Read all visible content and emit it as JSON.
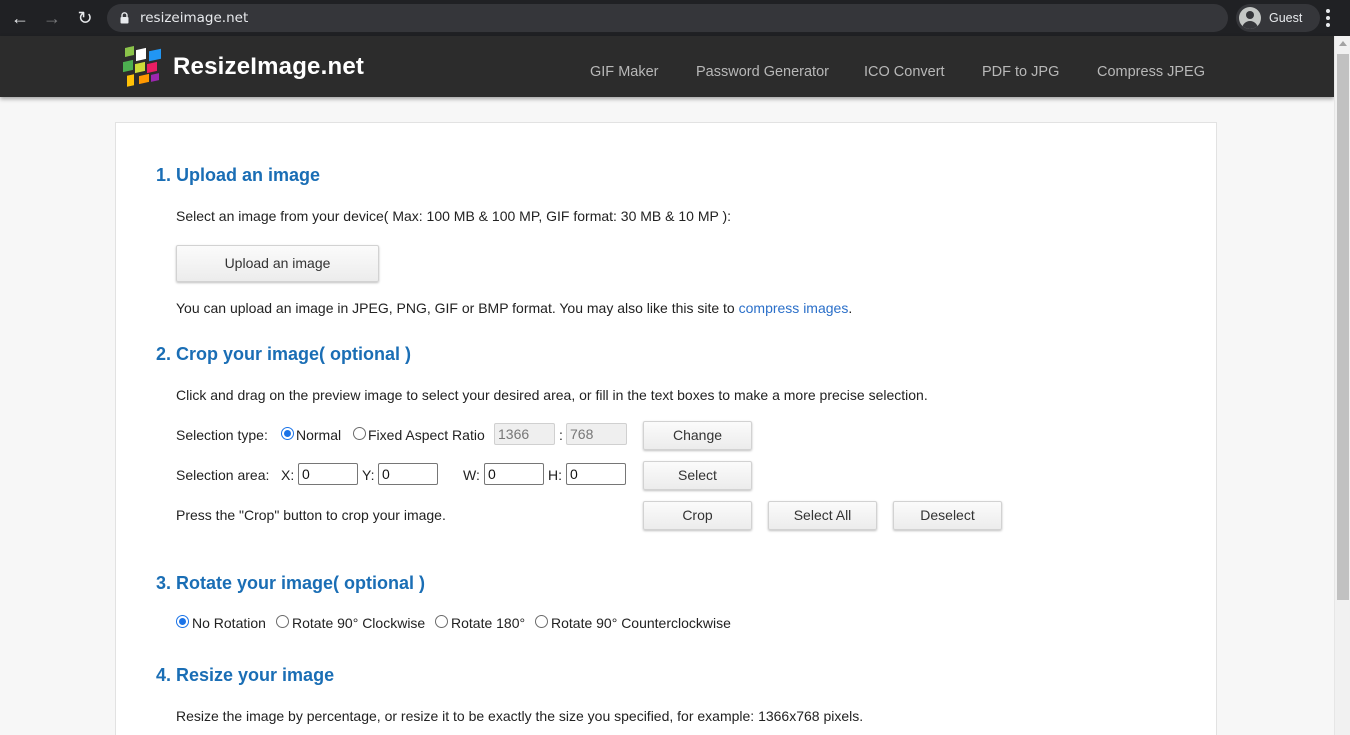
{
  "browser": {
    "url": "resizeimage.net",
    "profile_name": "Guest",
    "back_icon": "←",
    "forward_icon": "→",
    "reload_icon": "↻"
  },
  "site": {
    "logo_text": "ResizeImage.net",
    "nav": [
      "GIF Maker",
      "Password Generator",
      "ICO Convert",
      "PDF to JPG",
      "Compress JPEG"
    ]
  },
  "upload": {
    "heading": "1. Upload an image",
    "instructions": "Select an image from your device( Max: 100 MB & 100 MP, GIF format: 30 MB & 10 MP ):",
    "button_label": "Upload an image",
    "formats_text": "You can upload an image in JPEG, PNG, GIF or BMP format. You may also like this site to ",
    "compress_link": "compress images",
    "period": "."
  },
  "crop": {
    "heading": "2. Crop your image( optional )",
    "instructions": "Click and drag on the preview image to select your desired area, or fill in the text boxes to make a more precise selection.",
    "selection_type_label": "Selection type:",
    "normal_label": "Normal",
    "fixed_ratio_label": "Fixed Aspect Ratio",
    "ratio_width": "1366",
    "ratio_sep": ":",
    "ratio_height": "768",
    "change_label": "Change",
    "selection_area_label": "Selection area:",
    "x_label": "X:",
    "x_value": "0",
    "y_label": "Y:",
    "y_value": "0",
    "w_label": "W:",
    "w_value": "0",
    "h_label": "H:",
    "h_value": "0",
    "select_label": "Select",
    "press_text": "Press the \"Crop\" button to crop your image.",
    "crop_label": "Crop",
    "select_all_label": "Select All",
    "deselect_label": "Deselect"
  },
  "rotate": {
    "heading": "3. Rotate your image( optional )",
    "options": [
      "No Rotation",
      "Rotate 90° Clockwise",
      "Rotate 180°",
      "Rotate 90° Counterclockwise"
    ],
    "selected": "No Rotation"
  },
  "resize": {
    "heading": "4. Resize your image",
    "instructions": "Resize the image by percentage, or resize it to be exactly the size you specified, for example: 1366x768 pixels."
  },
  "colors": {
    "heading_blue": "#1a6eb5",
    "link_blue": "#2a6fc9",
    "header_bg": "#2c2c2c",
    "radio_blue": "#1a73e8"
  }
}
